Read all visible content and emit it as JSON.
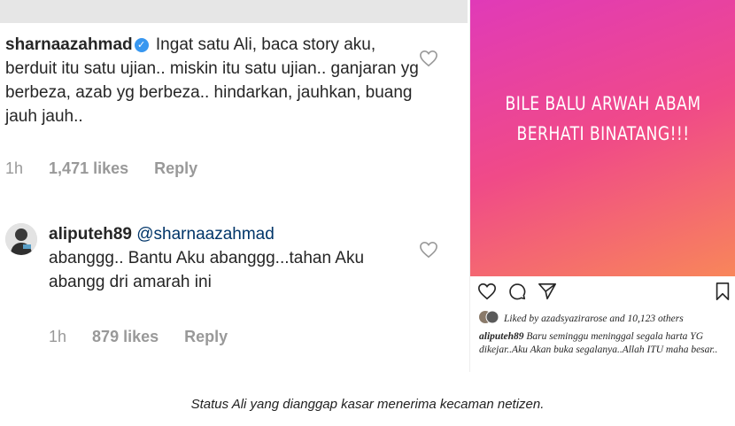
{
  "comment1": {
    "username": "sharnaazahmad",
    "text": "Ingat satu Ali, baca story aku, berduit itu satu ujian.. miskin itu satu ujian.. ganjaran yg berbeza, azab yg berbeza.. hindarkan, jauhkan, buang jauh jauh..",
    "time": "1h",
    "likes": "1,471 likes",
    "reply": "Reply"
  },
  "comment2": {
    "username": "aliputeh89",
    "mention": "@sharnaazahmad",
    "text": "abanggg.. Bantu Aku abanggg...tahan Aku abangg dri amarah ini",
    "time": "1h",
    "likes": "879 likes",
    "reply": "Reply"
  },
  "post": {
    "story_line1": "BILE BALU ARWAH ABAM",
    "story_line2": "BERHATI BINATANG!!!",
    "liked_by": "Liked by azadsyazirarose and 10,123 others",
    "caption_user": "aliputeh89",
    "caption_text": "Baru seminggu meninggal segala harta YG dikejar..Aku Akan buka segalanya..Allah ITU maha besar..",
    "gradient_colors": [
      "#e03ab8",
      "#f04a88",
      "#f8865a"
    ]
  },
  "figure_caption": "Status Ali yang dianggap kasar menerima kecaman netizen."
}
